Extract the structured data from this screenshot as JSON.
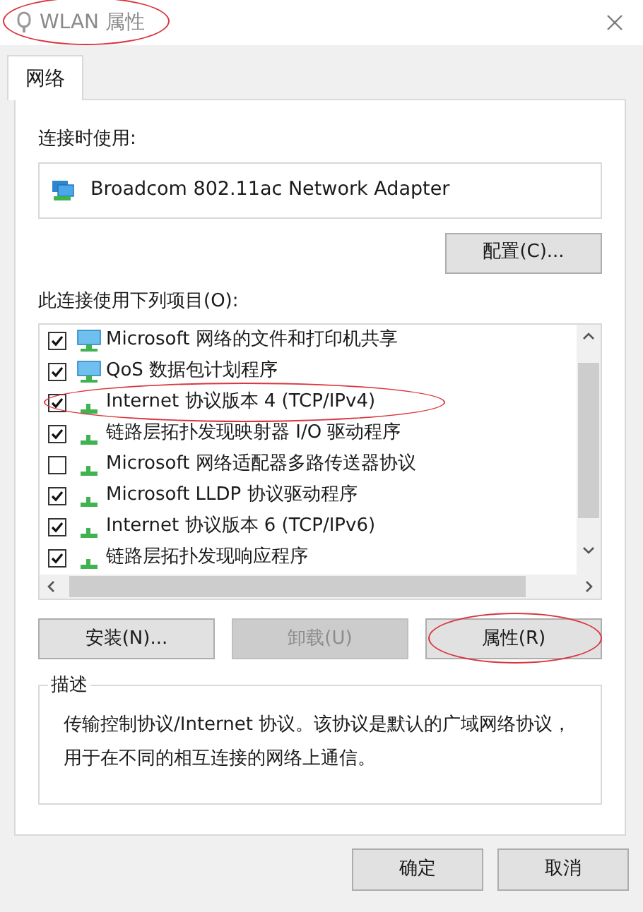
{
  "window": {
    "title": "WLAN 属性",
    "circled": true
  },
  "tabs": [
    {
      "label": "网络",
      "selected": true
    }
  ],
  "connect_using": {
    "label": "连接时使用:",
    "adapter": "Broadcom 802.11ac Network Adapter",
    "configure_button": {
      "label": "配置(C)..."
    }
  },
  "components": {
    "label": "此连接使用下列项目(O):",
    "items": [
      {
        "label": "Microsoft 网络的文件和打印机共享",
        "checked": true,
        "kind": "service",
        "circled": false
      },
      {
        "label": "QoS 数据包计划程序",
        "checked": true,
        "kind": "service",
        "circled": false
      },
      {
        "label": "Internet 协议版本 4 (TCP/IPv4)",
        "checked": true,
        "kind": "protocol",
        "circled": true
      },
      {
        "label": "链路层拓扑发现映射器 I/O 驱动程序",
        "checked": true,
        "kind": "protocol",
        "circled": false
      },
      {
        "label": "Microsoft 网络适配器多路传送器协议",
        "checked": false,
        "kind": "protocol",
        "circled": false
      },
      {
        "label": "Microsoft LLDP 协议驱动程序",
        "checked": true,
        "kind": "protocol",
        "circled": false
      },
      {
        "label": "Internet 协议版本 6 (TCP/IPv6)",
        "checked": true,
        "kind": "protocol",
        "circled": false
      },
      {
        "label": "链路层拓扑发现响应程序",
        "checked": true,
        "kind": "protocol",
        "circled": false
      }
    ]
  },
  "item_buttons": [
    {
      "label": "安装(N)...",
      "disabled": false,
      "circled": false
    },
    {
      "label": "卸载(U)",
      "disabled": true,
      "circled": false
    },
    {
      "label": "属性(R)",
      "disabled": false,
      "circled": true
    }
  ],
  "description": {
    "label": "描述",
    "text": "传输控制协议/Internet 协议。该协议是默认的广域网络协议，用于在不同的相互连接的网络上通信。"
  },
  "dialog_buttons": [
    {
      "label": "确定"
    },
    {
      "label": "取消"
    }
  ]
}
